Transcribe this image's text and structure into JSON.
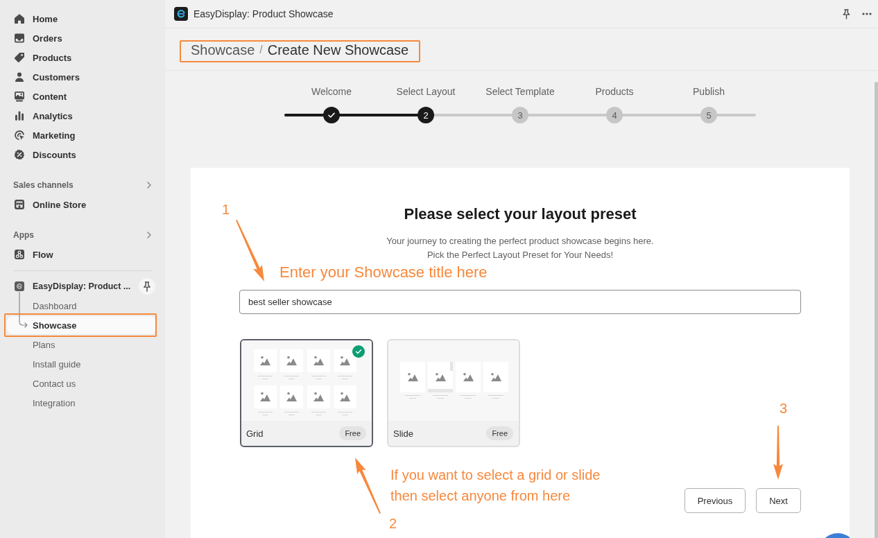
{
  "sidebar": {
    "nav_items": [
      {
        "label": "Home"
      },
      {
        "label": "Orders"
      },
      {
        "label": "Products"
      },
      {
        "label": "Customers"
      },
      {
        "label": "Content"
      },
      {
        "label": "Analytics"
      },
      {
        "label": "Marketing"
      },
      {
        "label": "Discounts"
      }
    ],
    "sections": [
      {
        "heading": "Sales channels",
        "items": [
          {
            "label": "Online Store"
          }
        ]
      },
      {
        "heading": "Apps",
        "items": [
          {
            "label": "Flow"
          }
        ]
      }
    ],
    "app": {
      "name": "EasyDisplay: Product ...",
      "children": [
        {
          "label": "Dashboard",
          "selected": false,
          "highlighted": false
        },
        {
          "label": "Showcase",
          "selected": true,
          "highlighted": true
        },
        {
          "label": "Plans",
          "selected": false,
          "highlighted": false
        },
        {
          "label": "Install guide",
          "selected": false,
          "highlighted": false
        },
        {
          "label": "Contact us",
          "selected": false,
          "highlighted": false
        },
        {
          "label": "Integration",
          "selected": false,
          "highlighted": false
        }
      ]
    }
  },
  "app_bar": {
    "title": "EasyDisplay: Product Showcase"
  },
  "breadcrumb": {
    "items": [
      "Showcase",
      "Create New Showcase"
    ],
    "separator": "/",
    "highlighted": true
  },
  "stepper": {
    "steps": [
      {
        "label": "Welcome",
        "completed": true,
        "selected": false
      },
      {
        "label": "Select Layout",
        "number": "2",
        "completed": false,
        "selected": true
      },
      {
        "label": "Select Template",
        "number": "3",
        "completed": false,
        "selected": false
      },
      {
        "label": "Products",
        "number": "4",
        "completed": false,
        "selected": false
      },
      {
        "label": "Publish",
        "number": "5",
        "completed": false,
        "selected": false
      }
    ]
  },
  "card": {
    "title": "Please select your layout preset",
    "subtitle": [
      "Your journey to creating the perfect product showcase begins here.",
      "Pick the Perfect Layout Preset for Your Needs!"
    ],
    "title_field": {
      "value": "best seller showcase"
    },
    "layouts": [
      {
        "kind": "grid",
        "name": "Grid",
        "badge": "Free",
        "selected": true
      },
      {
        "kind": "slide",
        "name": "Slide",
        "badge": "Free",
        "selected": false
      }
    ],
    "buttons": [
      {
        "label": "Previous"
      },
      {
        "label": "Next"
      }
    ]
  },
  "annotations": [
    {
      "number": "1",
      "text": "Enter your Showcase title here"
    },
    {
      "number": "2",
      "text": "If you want to select a grid or slide then select anyone from here"
    },
    {
      "number": "3"
    }
  ]
}
